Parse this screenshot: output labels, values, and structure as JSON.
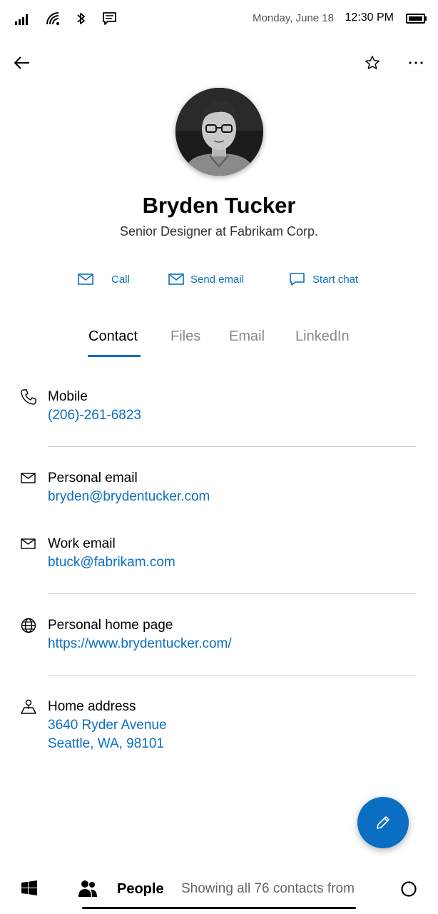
{
  "status_bar": {
    "date": "Monday, June 18",
    "time": "12:30 PM",
    "icons": [
      "signal-icon",
      "wifi-icon",
      "bluetooth-icon",
      "message-icon",
      "battery-icon"
    ]
  },
  "app_bar": {
    "icons": [
      "back-arrow-icon",
      "star-icon",
      "more-icon"
    ]
  },
  "profile": {
    "name": "Bryden Tucker",
    "subtitle": "Senior Designer at Fabrikam Corp."
  },
  "actions": [
    {
      "label": "Call",
      "icon": "mail-icon"
    },
    {
      "label": "Send email",
      "icon": "mail-icon"
    },
    {
      "label": "Start chat",
      "icon": "chat-icon"
    }
  ],
  "tabs": [
    {
      "label": "Contact",
      "active": true
    },
    {
      "label": "Files",
      "active": false
    },
    {
      "label": "Email",
      "active": false
    },
    {
      "label": "LinkedIn",
      "active": false
    }
  ],
  "contact": {
    "mobile": {
      "label": "Mobile",
      "value": "(206)-261-6823",
      "icon": "phone-icon"
    },
    "personal_email": {
      "label": "Personal email",
      "value": "bryden@brydentucker.com",
      "icon": "mail-icon"
    },
    "work_email": {
      "label": "Work email",
      "value": "btuck@fabrikam.com",
      "icon": "mail-icon"
    },
    "home_page": {
      "label": "Personal home page",
      "value": "https://www.brydentucker.com/",
      "icon": "globe-icon"
    },
    "home_address": {
      "label": "Home address",
      "line1": "3640 Ryder Avenue",
      "line2": "Seattle, WA, 98101",
      "icon": "map-pin-icon"
    }
  },
  "fab": {
    "icon": "pencil-icon"
  },
  "taskbar": {
    "app_label": "People",
    "status_text": "Showing all 76 contacts from",
    "icons": [
      "windows-start-icon",
      "people-icon",
      "search-circle-icon"
    ]
  },
  "colors": {
    "accent": "#0a6fc2",
    "text": "#000000",
    "muted": "#8a8a8a",
    "divider": "#cfcfcf"
  }
}
